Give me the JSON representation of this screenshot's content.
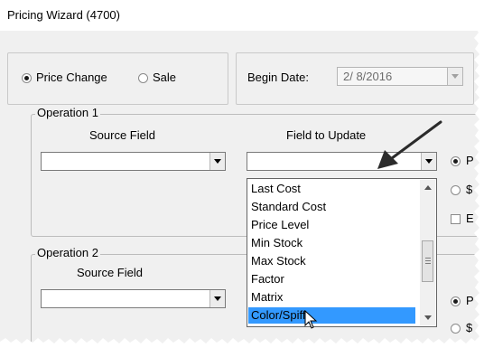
{
  "window": {
    "title": "Pricing Wizard (4700)"
  },
  "mode": {
    "price_change_label": "Price Change",
    "sale_label": "Sale",
    "selected": "Price Change"
  },
  "begin_date": {
    "label": "Begin Date:",
    "value": "2/ 8/2016"
  },
  "operation1": {
    "title": "Operation 1",
    "source_field_label": "Source Field",
    "source_field_value": "",
    "field_to_update_label": "Field to Update",
    "field_to_update_value": "",
    "radio_p_label": "P",
    "radio_s_label": "$",
    "check_e_label": "E"
  },
  "operation2": {
    "title": "Operation 2",
    "source_field_label": "Source Field",
    "source_field_value": "",
    "radio_p_label": "P",
    "radio_s_label": "$"
  },
  "dropdown": {
    "items": [
      "Last Cost",
      "Standard Cost",
      "Price Level",
      "Min Stock",
      "Max Stock",
      "Factor",
      "Matrix",
      "Color/Spiff"
    ],
    "selected": "Color/Spiff"
  },
  "colors": {
    "selection": "#3399ff",
    "window_bg": "#f0f0f0",
    "annotation_arrow": "#2b2b2b"
  },
  "icons": [
    "dropdown-arrow-icon",
    "mouse-cursor-icon",
    "annotation-arrow-icon",
    "scroll-up-icon",
    "scroll-down-icon"
  ]
}
